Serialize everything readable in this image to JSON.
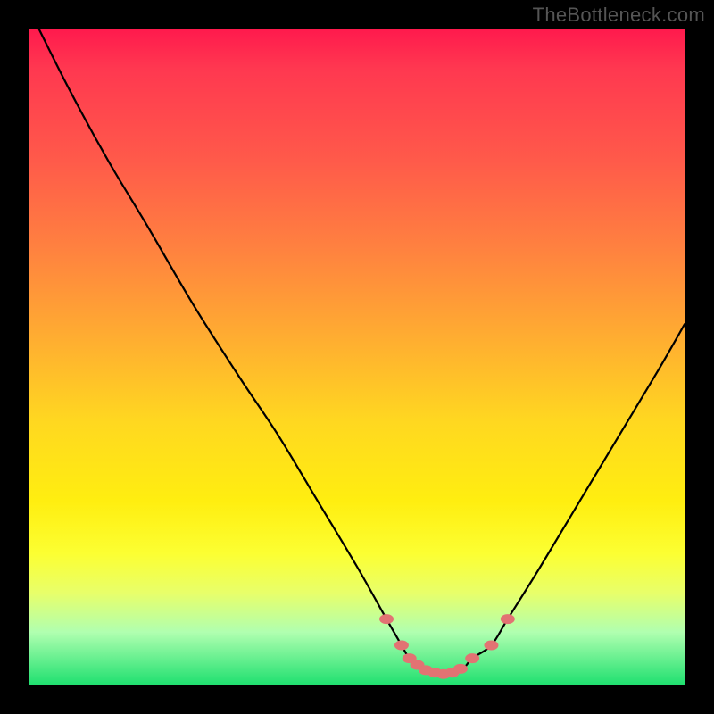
{
  "watermark": "TheBottleneck.com",
  "colors": {
    "background": "#000000",
    "curve": "#000000",
    "dot_fill": "#e27373",
    "gradient_top": "#ff1a4d",
    "gradient_bottom": "#20e070"
  },
  "chart_data": {
    "type": "line",
    "title": "",
    "xlabel": "",
    "ylabel": "",
    "xlim": [
      0,
      100
    ],
    "ylim": [
      0,
      100
    ],
    "series": [
      {
        "name": "bottleneck-curve",
        "x": [
          0,
          6,
          12,
          18,
          25,
          32,
          38,
          44,
          50,
          54.5,
          56.8,
          58,
          60,
          62,
          64,
          66,
          67.6,
          70.5,
          73,
          78,
          84,
          90,
          96,
          100
        ],
        "values": [
          103,
          91,
          80,
          70,
          58,
          47,
          38,
          28,
          18,
          10,
          6,
          4,
          2.2,
          1.6,
          1.6,
          2.2,
          4,
          6,
          10,
          18,
          28,
          38,
          48,
          55
        ]
      }
    ],
    "highlight_dots": {
      "name": "sweet-spot-dots",
      "x": [
        54.5,
        56.8,
        58,
        59.2,
        60.5,
        61.9,
        63.2,
        64.5,
        65.8,
        67.6,
        70.5,
        73
      ],
      "values": [
        10,
        6,
        4,
        3,
        2.2,
        1.8,
        1.6,
        1.8,
        2.4,
        4,
        6,
        10
      ]
    }
  }
}
